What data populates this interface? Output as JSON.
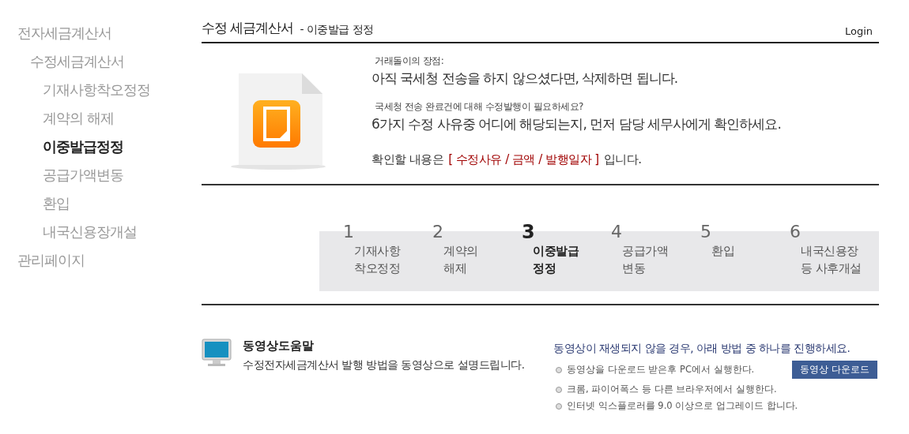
{
  "sidebar": {
    "items": [
      {
        "label": "전자세금계산서",
        "selected": false,
        "children": [
          {
            "label": "수정세금계산서",
            "selected": false,
            "children": [
              {
                "label": "기재사항착오정정",
                "selected": false
              },
              {
                "label": "계약의 해제",
                "selected": false
              },
              {
                "label": "이중발급정정",
                "selected": true
              },
              {
                "label": "공급가액변동",
                "selected": false
              },
              {
                "label": "환입",
                "selected": false
              },
              {
                "label": "내국신용장개설",
                "selected": false
              }
            ]
          }
        ]
      },
      {
        "label": "관리페이지",
        "selected": false
      }
    ]
  },
  "header": {
    "title": "수정 세금계산서",
    "subtitle": "- 이중발급 정정",
    "login": "Login"
  },
  "intro": {
    "caption_1": "거래돌이의 장점:",
    "message_1": "아직 국세청 전송을 하지 않으셨다면, 삭제하면 됩니다.",
    "caption_2": "국세청 전송 완료건에 대해 수정발행이 필요하세요?",
    "message_2": "6가지 수정 사유중 어디에 해당되는지,  먼저 담당 세무사에게 확인하세요.",
    "check": {
      "before": "확인할 내용은",
      "highlight": "[ 수정사유 / 금액 / 발행일자 ]",
      "after": "입니다."
    }
  },
  "steps": [
    {
      "number": "1",
      "lines": [
        "기재사항",
        "착오정정"
      ],
      "selected": false
    },
    {
      "number": "2",
      "lines": [
        "계약의",
        "해제"
      ],
      "selected": false
    },
    {
      "number": "3",
      "lines": [
        "이중발급",
        "정정"
      ],
      "selected": true
    },
    {
      "number": "4",
      "lines": [
        "공급가액",
        "변동"
      ],
      "selected": false
    },
    {
      "number": "5",
      "lines": [
        "환입"
      ],
      "selected": false
    },
    {
      "number": "6",
      "lines": [
        "내국신용장",
        "등 사후개설"
      ],
      "selected": false
    }
  ],
  "video_help": {
    "title": "동영상도움말",
    "description": "수정전자세금계산서 발행 방법을 동영상으로 설명드립니다."
  },
  "troubleshoot": {
    "heading": "동영상이 재생되지 않을 경우, 아래 방법 중 하나를 진행하세요.",
    "tips": [
      "동영상을 다운로드 받은후 PC에서 실행한다.",
      "크롬, 파이어폭스 등 다른 브라우저에서 실행한다.",
      "인터넷 익스플로러를 9.0 이상으로 업그레이드 합니다."
    ],
    "download_button": "동영상 다운로드"
  }
}
